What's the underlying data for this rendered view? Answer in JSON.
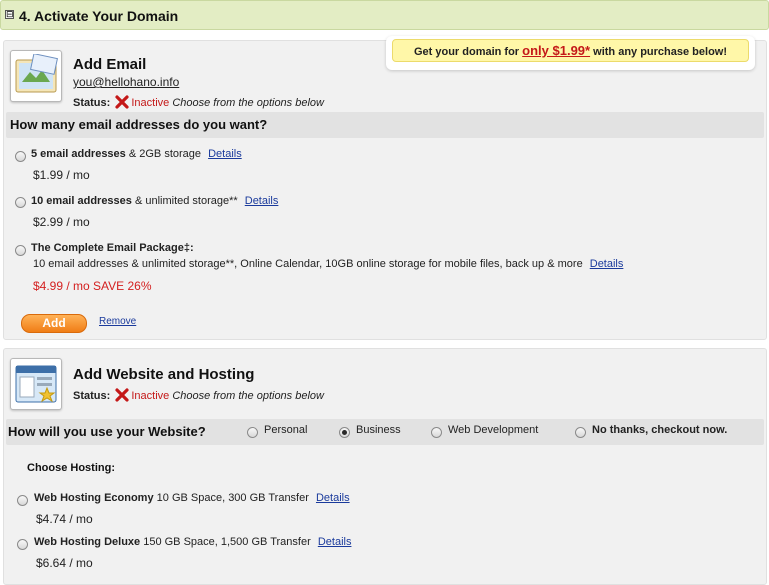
{
  "section": {
    "title": "4. Activate Your Domain",
    "toggle_symbol": "⊟"
  },
  "promo": {
    "prefix": "Get your domain for ",
    "price": "only $1.99*",
    "suffix": " with any purchase below!"
  },
  "email": {
    "title": "Add Email",
    "address": "you@hellohano.info",
    "status_label": "Status:",
    "status_value": "Inactive",
    "status_note": "Choose from the options below",
    "question": "How many email addresses do you want?",
    "options": [
      {
        "name": "5 email addresses",
        "detail": " & 2GB storage",
        "link": "Details",
        "price": "$1.99 / mo"
      },
      {
        "name": "10 email addresses",
        "detail": " & unlimited storage**",
        "link": "Details",
        "price": "$2.99 / mo"
      },
      {
        "name": "The Complete Email Package‡:",
        "description": "10 email addresses & unlimited storage**, Online Calendar, 10GB online storage for mobile files, back up & more",
        "link": "Details",
        "price": "$4.99 / mo SAVE 26%"
      }
    ],
    "add_label": "Add",
    "remove_label": "Remove"
  },
  "website": {
    "title": "Add Website and Hosting",
    "status_label": "Status:",
    "status_value": "Inactive",
    "status_note": "Choose from the options below",
    "question": "How will you use your Website?",
    "use_options": [
      {
        "label": "Personal",
        "selected": false
      },
      {
        "label": "Business",
        "selected": true
      },
      {
        "label": "Web Development",
        "selected": false
      },
      {
        "label": "No thanks, checkout now.",
        "selected": false
      }
    ],
    "choose_hosting": "Choose Hosting:",
    "hosting": [
      {
        "name": "Web Hosting Economy",
        "detail": " 10 GB Space, 300 GB Transfer",
        "link": "Details",
        "price": "$4.74 / mo"
      },
      {
        "name": "Web Hosting Deluxe",
        "detail": " 150 GB Space, 1,500 GB Transfer",
        "link": "Details",
        "price": "$6.64 / mo"
      }
    ]
  },
  "colors": {
    "header_bg": "#e3edc4",
    "panel_bg": "#f1f1f1",
    "accent_red": "#c41818",
    "link_blue": "#1a3a9c",
    "button_orange": "#f07d16"
  },
  "icons": {
    "toggle": "collapse-icon",
    "email": "email-product-icon",
    "website": "website-product-icon",
    "status": "inactive-x-icon"
  }
}
